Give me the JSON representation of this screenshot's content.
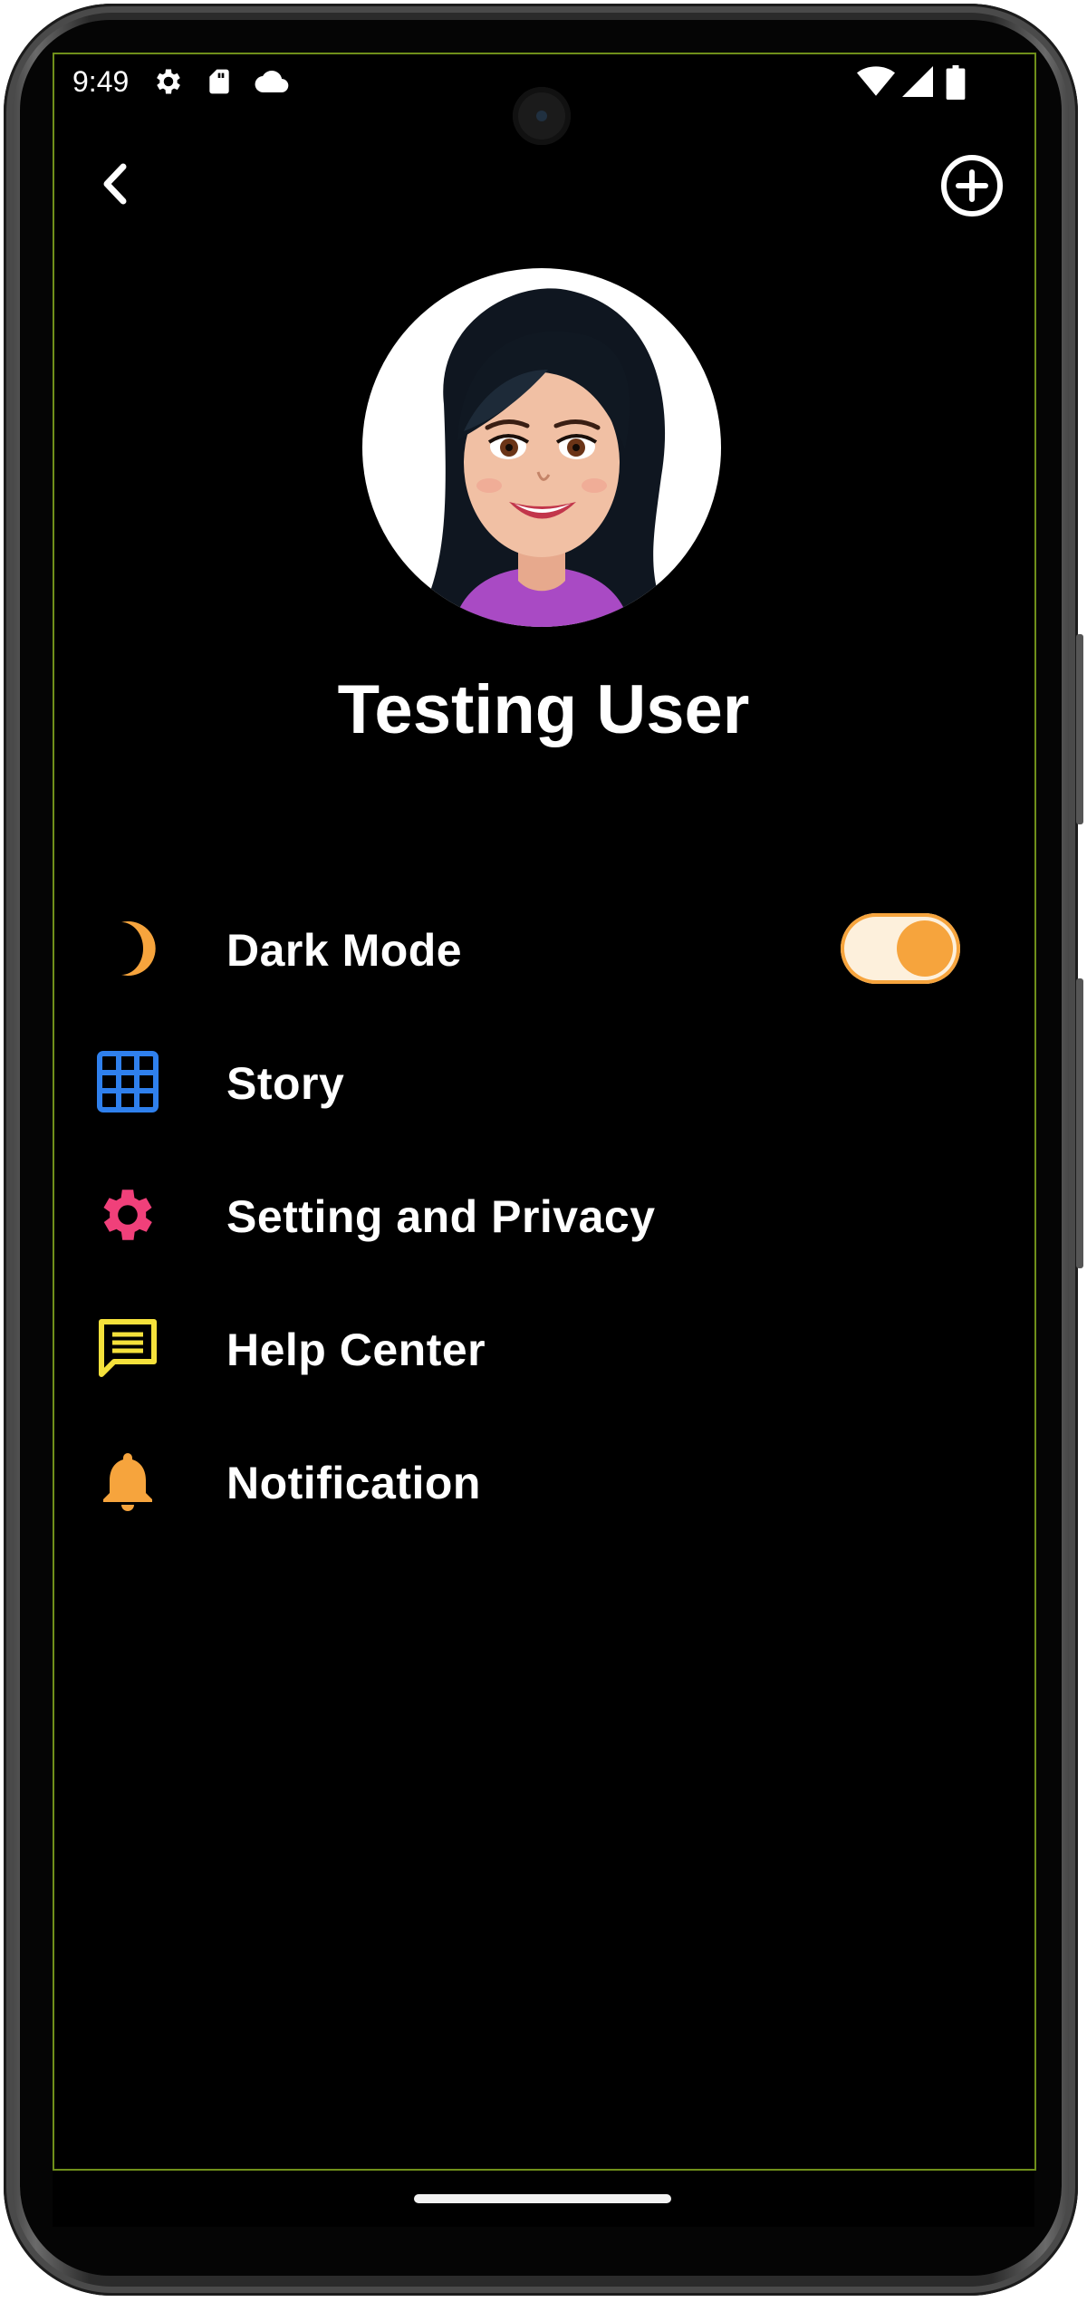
{
  "status_bar": {
    "time": "9:49",
    "left_icons": [
      "gear-icon",
      "sd-card-icon",
      "cloud-icon"
    ],
    "right_icons": [
      "wifi-icon",
      "signal-icon",
      "battery-icon"
    ]
  },
  "top_bar": {
    "back_icon": "chevron-left-icon",
    "action_icon": "add-circle-icon"
  },
  "profile": {
    "name": "Testing User",
    "avatar": "cartoon-woman-avatar"
  },
  "menu": {
    "items": [
      {
        "label": "Dark Mode",
        "icon": "moon-icon",
        "icon_color": "#F6A43D",
        "toggle_on": true
      },
      {
        "label": "Story",
        "icon": "grid-icon",
        "icon_color": "#2F80ED"
      },
      {
        "label": "Setting and Privacy",
        "icon": "gear-icon",
        "icon_color": "#F0407A"
      },
      {
        "label": "Help Center",
        "icon": "chat-message-icon",
        "icon_color": "#F5E13B"
      },
      {
        "label": "Notification",
        "icon": "bell-icon",
        "icon_color": "#F6A43D"
      }
    ]
  },
  "colors": {
    "background": "#000000",
    "text": "#FFFFFF",
    "accent": "#F6A43D"
  }
}
